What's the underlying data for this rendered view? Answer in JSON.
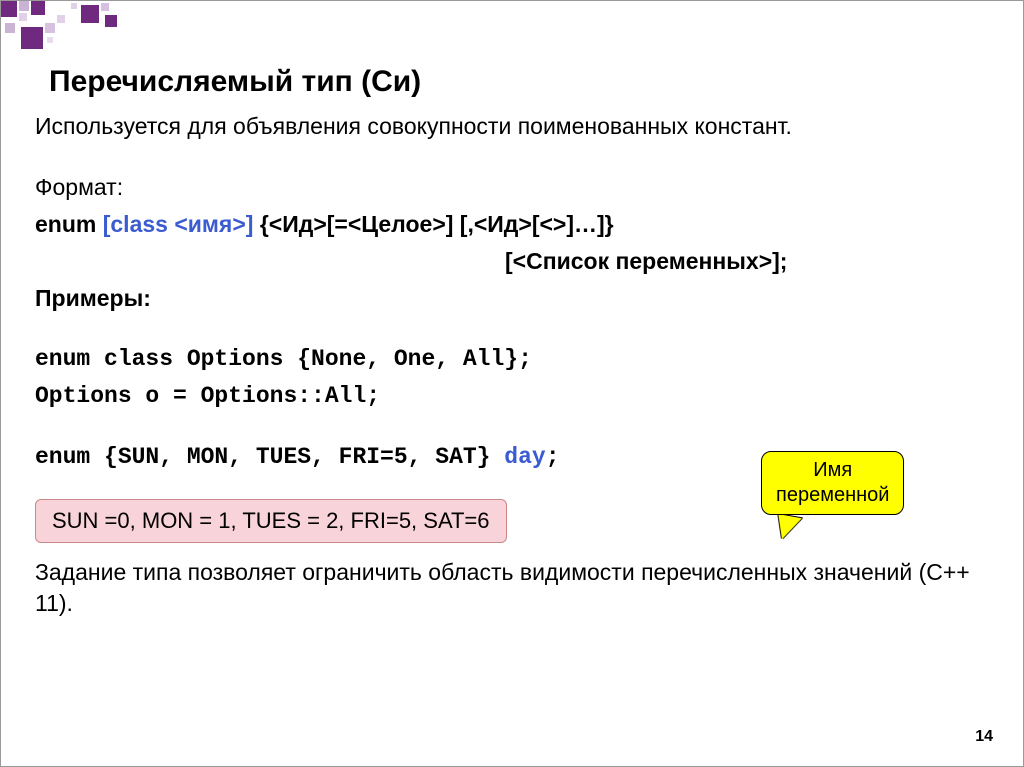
{
  "title": "Перечисляемый тип (Си)",
  "intro": "Используется для объявления совокупности поименованных констант.",
  "format_label": "Формат:",
  "format_kw": "enum ",
  "format_blue": "[class <имя>]",
  "format_rest": " {<Ид>[=<Целое>] [,<Ид>[<>]…]}",
  "format_line2": "[<Список переменных>];",
  "examples_label": "Примеры:",
  "ex1": "enum class Options {None, One, All};",
  "ex2": "Options o = Options::All;",
  "ex3a": "enum {SUN, MON, TUES, FRI=5, SAT} ",
  "ex3b": "day",
  "ex3c": ";",
  "pink": "SUN =0, MON = 1, TUES = 2, FRI=5, SAT=6",
  "note": "Задание типа позволяет ограничить область видимости перечисленных значений (С++ 11).",
  "callout_l1": "Имя",
  "callout_l2": "переменной",
  "page": "14"
}
